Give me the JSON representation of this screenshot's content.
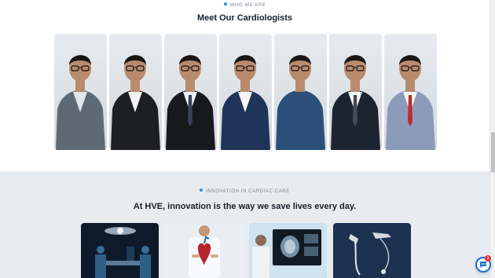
{
  "team_section": {
    "eyebrow": "WHO WE ARE",
    "title": "Meet Our Cardiologists",
    "accent_color": "#2f8fd8",
    "doctors": [
      {
        "suit": "#5e6a73",
        "shirt": "#dfe6ec",
        "tie": null
      },
      {
        "suit": "#1d1f22",
        "shirt": "#f2f2f2",
        "tie": null
      },
      {
        "suit": "#17191c",
        "shirt": "#eef1f4",
        "tie": "#3a3f5a"
      },
      {
        "suit": "#1f3458",
        "shirt": "#f4f6f8",
        "tie": null
      },
      {
        "suit": "#2b4f78",
        "shirt": "#2b4f78",
        "tie": null
      },
      {
        "suit": "#1c2430",
        "shirt": "#f4f6f8",
        "tie": "#444a52"
      },
      {
        "suit": "#8d9bbb",
        "shirt": "#f6f7f9",
        "tie": "#c0282d"
      }
    ]
  },
  "innovation_section": {
    "eyebrow": "INNOVATION IN CARDIAC CARE",
    "title": "At HVE, innovation is the way we save lives every day.",
    "cards": [
      {
        "icon": "surgery-room-image"
      },
      {
        "icon": "heart-model-image"
      },
      {
        "icon": "heart-scan-monitor-image"
      },
      {
        "icon": "cardiac-device-image"
      }
    ]
  },
  "chat_widget": {
    "badge_count": "1",
    "brand_color": "#1f6fd1"
  }
}
